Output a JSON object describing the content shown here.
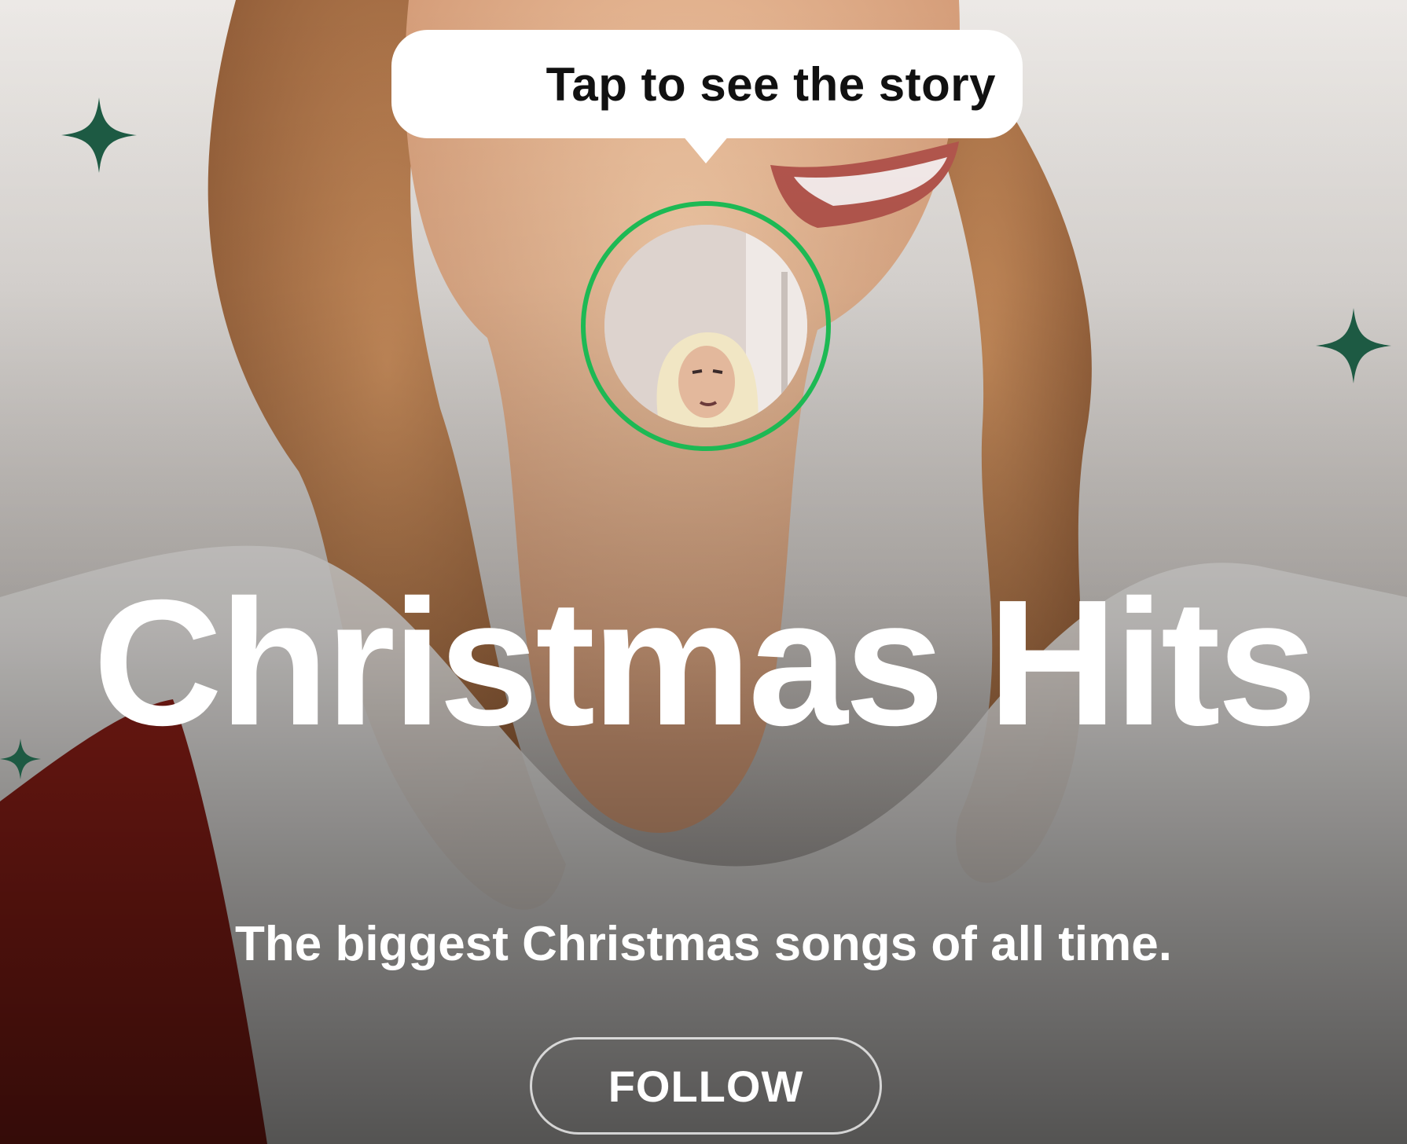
{
  "tooltip": {
    "text": "Tap to see the story"
  },
  "story": {
    "ring_color": "#1db954"
  },
  "playlist": {
    "title": "Christmas Hits",
    "description": "The biggest Christmas songs of all time.",
    "follow_label": "FOLLOW"
  },
  "decorations": {
    "sparkle_color": "#1d5a43",
    "sparkle_icon": "four-point-star-icon"
  },
  "colors": {
    "accent_green": "#1db954",
    "text_white": "#ffffff",
    "tooltip_bg": "#ffffff"
  }
}
